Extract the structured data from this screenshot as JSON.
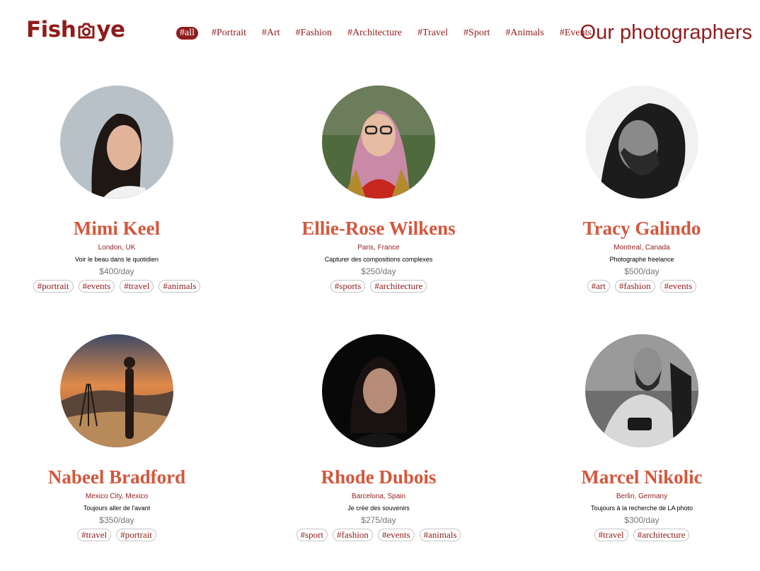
{
  "brand": {
    "logo_before": "Fish",
    "logo_after": "ye"
  },
  "nav": {
    "tags": [
      "#all",
      "#Portrait",
      "#Art",
      "#Fashion",
      "#Architecture",
      "#Travel",
      "#Sport",
      "#Animals",
      "#Events"
    ],
    "active": "#all"
  },
  "page_title": "Our photographers",
  "photographers": [
    {
      "name": "Mimi Keel",
      "location": "London, UK",
      "tagline": "Voir le beau dans le quotidien",
      "price": "$400/day",
      "tags": [
        "#portrait",
        "#events",
        "#travel",
        "#animals"
      ]
    },
    {
      "name": "Ellie-Rose Wilkens",
      "location": "Paris, France",
      "tagline": "Capturer des compositions complexes",
      "price": "$250/day",
      "tags": [
        "#sports",
        "#architecture"
      ]
    },
    {
      "name": "Tracy Galindo",
      "location": "Montreal, Canada",
      "tagline": "Photographe freelance",
      "price": "$500/day",
      "tags": [
        "#art",
        "#fashion",
        "#events"
      ]
    },
    {
      "name": "Nabeel Bradford",
      "location": "Mexico City, Mexico",
      "tagline": "Toujours aller de l'avant",
      "price": "$350/day",
      "tags": [
        "#travel",
        "#portrait"
      ]
    },
    {
      "name": "Rhode Dubois",
      "location": "Barcelona, Spain",
      "tagline": "Je crée des souvenirs",
      "price": "$275/day",
      "tags": [
        "#sport",
        "#fashion",
        "#events",
        "#animals"
      ]
    },
    {
      "name": "Marcel Nikolic",
      "location": "Berlin, Germany",
      "tagline": "Toujours à la recherche de LA photo",
      "price": "$300/day",
      "tags": [
        "#travel",
        "#architecture"
      ]
    }
  ],
  "colors": {
    "brand": "#901c1c",
    "name": "#d3573c",
    "price": "#757575",
    "tag_border": "#c4c4c4"
  }
}
